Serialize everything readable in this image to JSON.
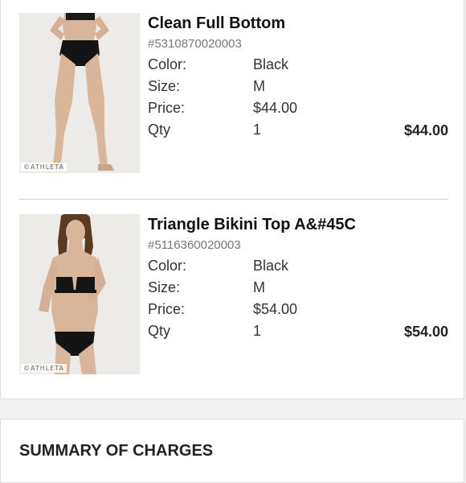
{
  "items": [
    {
      "name": "Clean Full Bottom",
      "sku": "#5310870020003",
      "color_label": "Color:",
      "color": "Black",
      "size_label": "Size:",
      "size": "M",
      "price_label": "Price:",
      "price": "$44.00",
      "qty_label": "Qty",
      "qty": "1",
      "line_total": "$44.00",
      "brand_mark": "©ATHLETA"
    },
    {
      "name": "Triangle Bikini Top A&#45C",
      "sku": "#5116360020003",
      "color_label": "Color:",
      "color": "Black",
      "size_label": "Size:",
      "size": "M",
      "price_label": "Price:",
      "price": "$54.00",
      "qty_label": "Qty",
      "qty": "1",
      "line_total": "$54.00",
      "brand_mark": "©ATHLETA"
    }
  ],
  "summary": {
    "title": "SUMMARY OF CHARGES"
  }
}
